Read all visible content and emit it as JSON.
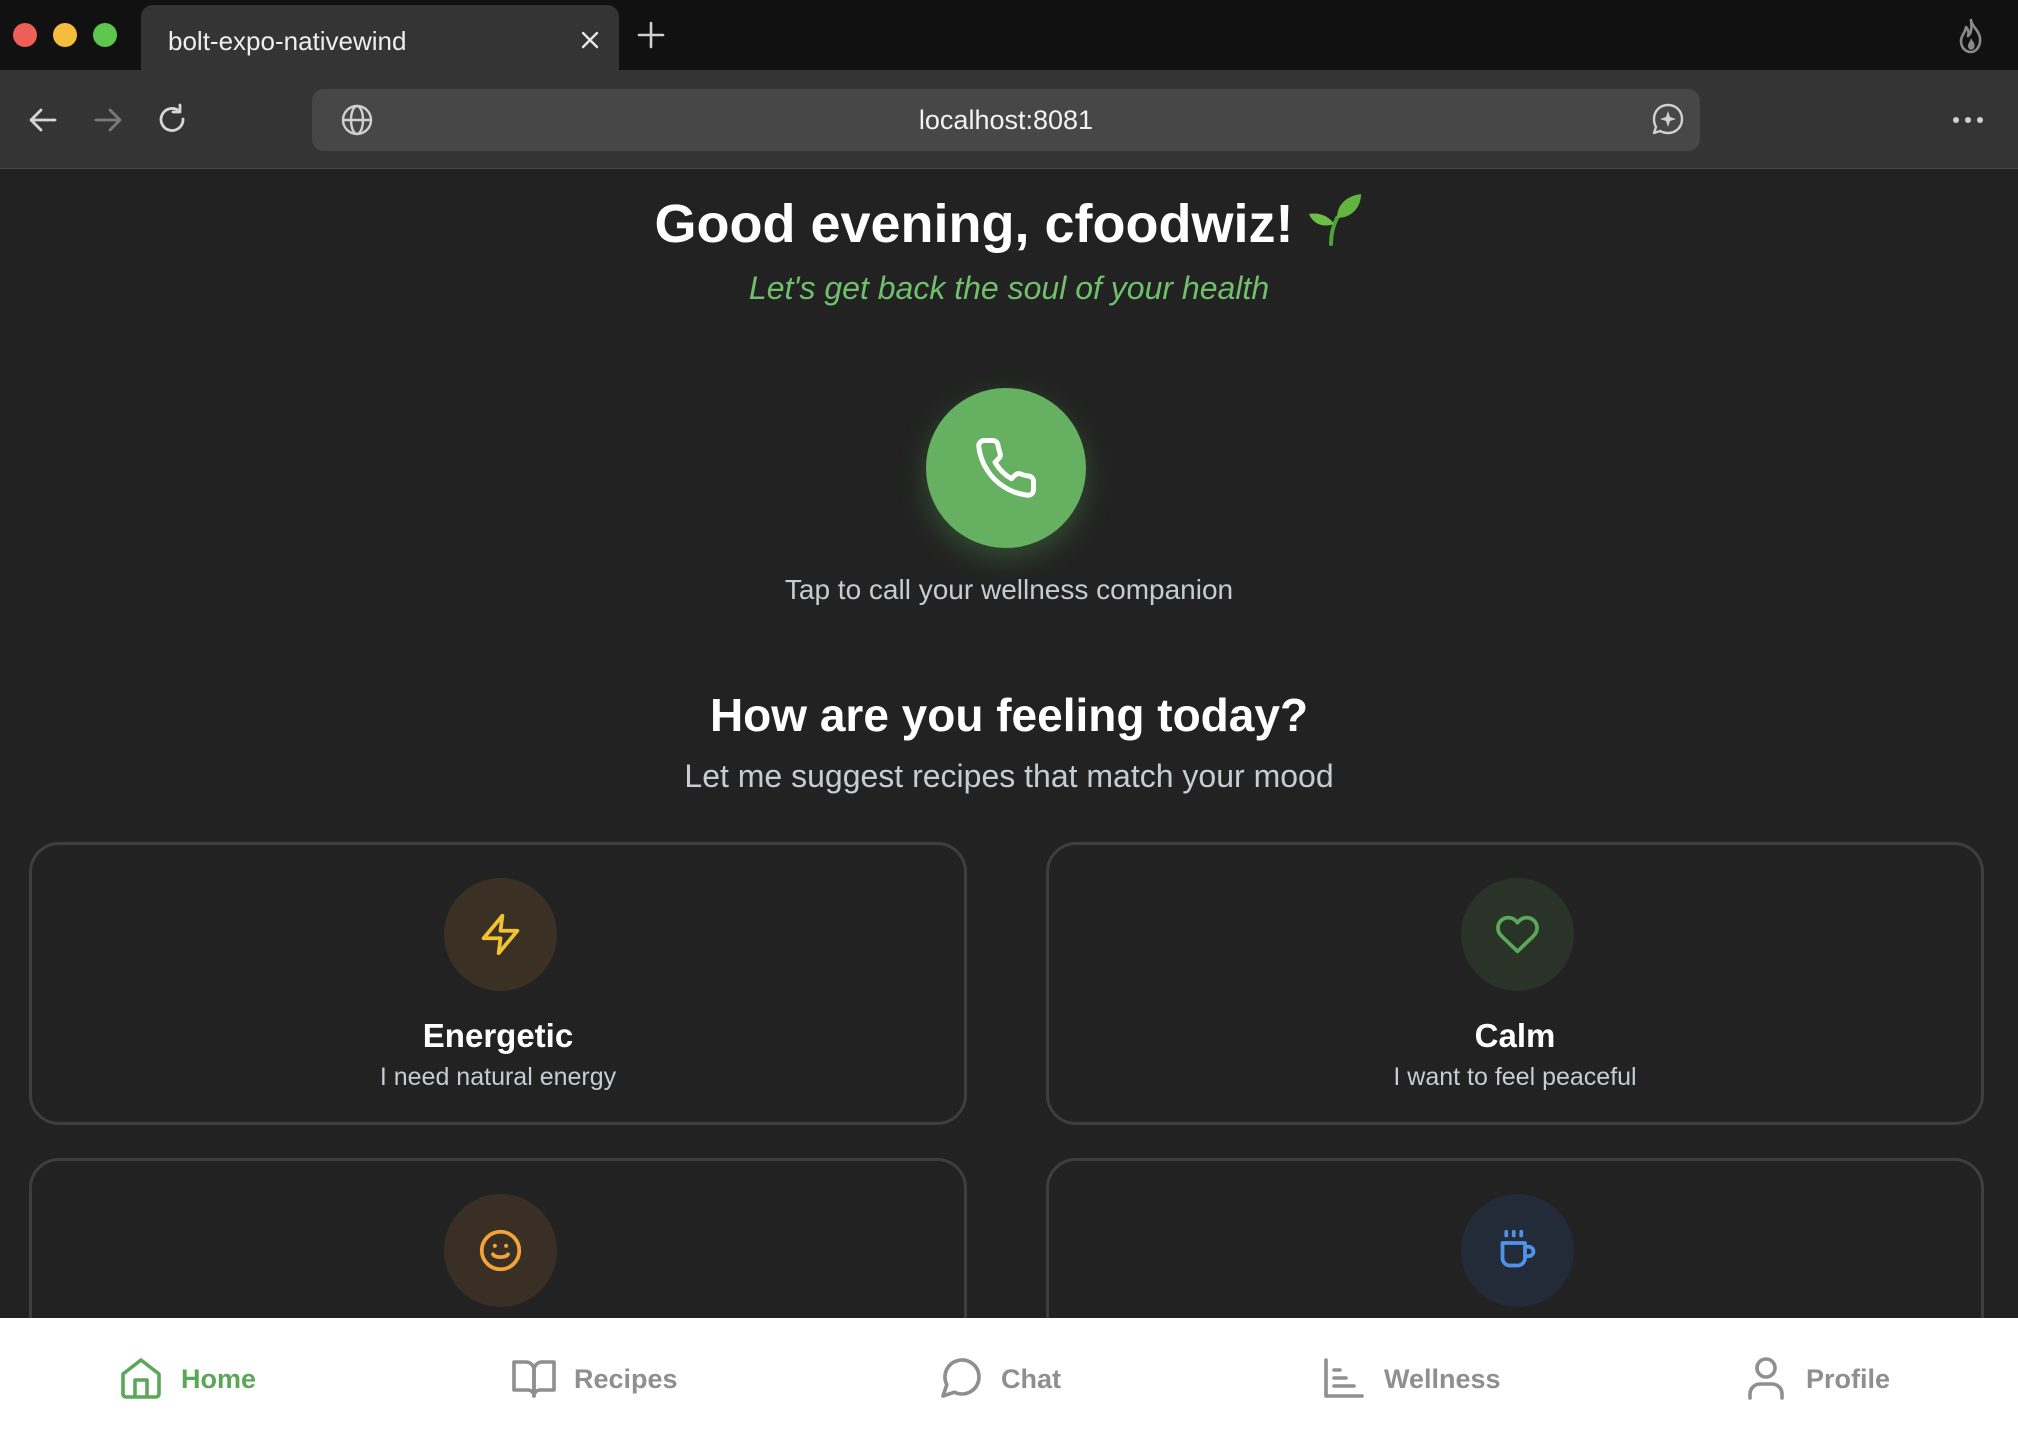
{
  "browser": {
    "tab_title": "bolt-expo-nativewind",
    "url": "localhost:8081"
  },
  "home": {
    "greeting": "Good evening, cfoodwiz!",
    "tagline": "Let's get back the soul of your health",
    "call_caption": "Tap to call your wellness companion",
    "feeling_title": "How are you feeling today?",
    "feeling_subtitle": "Let me suggest recipes that match your mood",
    "moods": [
      {
        "name": "Energetic",
        "description": "I need natural energy",
        "icon": "zap-icon",
        "color": "#f2c232"
      },
      {
        "name": "Calm",
        "description": "I want to feel peaceful",
        "icon": "heart-icon",
        "color": "#5aa857"
      },
      {
        "name": "",
        "description": "",
        "icon": "smile-icon",
        "color": "#f0a43a"
      },
      {
        "name": "",
        "description": "",
        "icon": "coffee-icon",
        "color": "#4f93e8"
      }
    ]
  },
  "tabbar": {
    "items": [
      {
        "label": "Home",
        "icon": "home-icon",
        "active": true
      },
      {
        "label": "Recipes",
        "icon": "book-icon",
        "active": false
      },
      {
        "label": "Chat",
        "icon": "chat-icon",
        "active": false
      },
      {
        "label": "Wellness",
        "icon": "chart-icon",
        "active": false
      },
      {
        "label": "Profile",
        "icon": "user-icon",
        "active": false
      }
    ]
  },
  "colors": {
    "accent_green": "#66b062",
    "background": "#222222",
    "tab_active": "#5aa857",
    "tab_inactive": "#8e8e93"
  }
}
